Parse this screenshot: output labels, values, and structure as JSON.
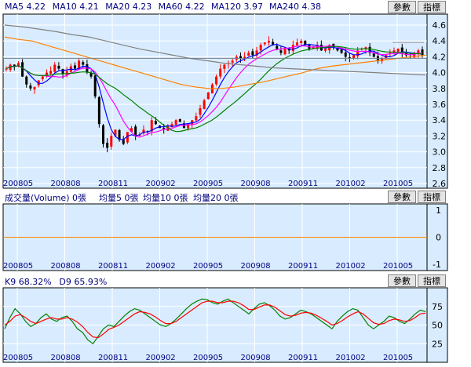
{
  "colors": {
    "background": "#ffffff",
    "plot_background": "#d9ecff",
    "axis_panel": "#d9ecff",
    "grid": "#ffffff",
    "candle_up": "#ff0000",
    "candle_down": "#000000",
    "ma5": "#0000ff",
    "ma10": "#ff00ff",
    "ma20": "#008000",
    "ma60": "#ff8000",
    "ma120": "#808080",
    "ma240": "#a0a0a0",
    "k": "#008000",
    "d": "#ff0000",
    "label": "#000080",
    "button_bg": "#e4e4e4"
  },
  "buttons": {
    "params": "參數",
    "indicator": "指標"
  },
  "chart_data": [
    {
      "type": "candlestick",
      "panel": "price",
      "legend": [
        {
          "label": "MA5",
          "value": "4.22"
        },
        {
          "label": "MA10",
          "value": "4.21"
        },
        {
          "label": "MA20",
          "value": "4.23"
        },
        {
          "label": "MA60",
          "value": "4.22"
        },
        {
          "label": "MA120",
          "value": "3.97"
        },
        {
          "label": "MA240",
          "value": "4.38"
        }
      ],
      "x_ticks": [
        "200805",
        "200808",
        "200811",
        "200902",
        "200905",
        "200908",
        "200911",
        "201002",
        "201005"
      ],
      "y_ticks": [
        "4.6",
        "4.4",
        "4.2",
        "4.0",
        "3.8",
        "3.6",
        "3.4",
        "3.2",
        "3.0",
        "2.8",
        "2.6"
      ],
      "ylim": [
        2.6,
        4.6
      ],
      "grid": true,
      "price_line": 4.18,
      "series": {
        "close": [
          4.05,
          4.1,
          4.08,
          4.12,
          3.95,
          3.85,
          3.8,
          3.82,
          3.9,
          3.95,
          4.0,
          4.02,
          4.1,
          4.05,
          3.98,
          4.02,
          4.08,
          4.05,
          4.15,
          4.1,
          4.0,
          3.95,
          3.7,
          3.35,
          3.1,
          3.05,
          3.2,
          3.28,
          3.15,
          3.1,
          3.25,
          3.3,
          3.2,
          3.22,
          3.28,
          3.25,
          3.4,
          3.35,
          3.3,
          3.28,
          3.32,
          3.35,
          3.4,
          3.38,
          3.3,
          3.35,
          3.4,
          3.45,
          3.55,
          3.65,
          3.75,
          3.85,
          3.95,
          4.05,
          4.1,
          4.12,
          4.15,
          4.2,
          4.18,
          4.2,
          4.25,
          4.22,
          4.28,
          4.35,
          4.38,
          4.4,
          4.35,
          4.3,
          4.25,
          4.3,
          4.28,
          4.35,
          4.38,
          4.4,
          4.35,
          4.3,
          4.32,
          4.35,
          4.28,
          4.3,
          4.35,
          4.32,
          4.28,
          4.25,
          4.2,
          4.18,
          4.22,
          4.28,
          4.3,
          4.32,
          4.25,
          4.2,
          4.15,
          4.18,
          4.22,
          4.25,
          4.28,
          4.3,
          4.25,
          4.22,
          4.2,
          4.25,
          4.28,
          4.22
        ],
        "volatility": 0.06
      },
      "moving_averages": {
        "ma5": {
          "color_key": "ma5"
        },
        "ma10": {
          "color_key": "ma10"
        },
        "ma20": {
          "color_key": "ma20"
        },
        "ma60": {
          "points": [
            4.45,
            4.42,
            4.4,
            4.35,
            4.3,
            4.25,
            4.2,
            4.15,
            4.1,
            4.05,
            4.0,
            3.95,
            3.9,
            3.85,
            3.82,
            3.8,
            3.8,
            3.82,
            3.85,
            3.88,
            3.92,
            3.96,
            4.0,
            4.05,
            4.08,
            4.1,
            4.12,
            4.14,
            4.16,
            4.18,
            4.2,
            4.22
          ],
          "color_key": "ma60"
        },
        "ma120": {
          "points": [
            4.6,
            4.58,
            4.55,
            4.52,
            4.48,
            4.45,
            4.4,
            4.35,
            4.3,
            4.26,
            4.22,
            4.18,
            4.15,
            4.12,
            4.1,
            4.08,
            4.06,
            4.05,
            4.04,
            4.03,
            4.02,
            4.01,
            4.0,
            3.99,
            3.98,
            3.97
          ],
          "color_key": "ma120"
        },
        "ma240": {
          "points": [
            4.38,
            4.38,
            4.38,
            4.38
          ],
          "color_key": "ma240"
        }
      }
    },
    {
      "type": "line",
      "panel": "volume",
      "title_text": "成交量(Volume) 0張",
      "legend": [
        {
          "label": "均量5",
          "value": "0張"
        },
        {
          "label": "均量10",
          "value": "0張"
        },
        {
          "label": "均量20",
          "value": "0張"
        }
      ],
      "x_ticks": [
        "200805",
        "200808",
        "200811",
        "200902",
        "200905",
        "200908",
        "200911",
        "201002",
        "201005"
      ],
      "y_ticks": [
        "1",
        "0",
        "-1"
      ],
      "ylim": [
        -1,
        1
      ],
      "series": [
        {
          "values": [
            0,
            0
          ]
        }
      ],
      "grid": true
    },
    {
      "type": "line",
      "panel": "kd",
      "legend": [
        {
          "label": "K9",
          "value": "68.32%"
        },
        {
          "label": "D9",
          "value": "65.93%"
        }
      ],
      "x_ticks": [
        "200805",
        "200808",
        "200811",
        "200902",
        "200905",
        "200908",
        "200911",
        "201002",
        "201005"
      ],
      "y_ticks": [
        "75",
        "50",
        "25"
      ],
      "ylim": [
        0,
        100
      ],
      "grid": true,
      "series": [
        {
          "key": "k",
          "values": [
            45,
            60,
            72,
            65,
            55,
            48,
            52,
            60,
            65,
            58,
            55,
            60,
            62,
            55,
            45,
            40,
            30,
            25,
            35,
            45,
            50,
            48,
            55,
            62,
            68,
            72,
            70,
            65,
            60,
            55,
            50,
            48,
            52,
            58,
            65,
            72,
            78,
            82,
            85,
            84,
            80,
            78,
            82,
            85,
            80,
            75,
            70,
            65,
            72,
            78,
            80,
            76,
            70,
            62,
            58,
            60,
            65,
            70,
            68,
            65,
            60,
            55,
            50,
            45,
            55,
            62,
            68,
            72,
            70,
            60,
            50,
            45,
            50,
            55,
            62,
            60,
            55,
            52,
            58,
            65,
            70,
            68
          ]
        },
        {
          "key": "d",
          "values": [
            50,
            55,
            62,
            64,
            60,
            55,
            52,
            55,
            58,
            60,
            58,
            58,
            60,
            58,
            54,
            48,
            40,
            34,
            33,
            38,
            44,
            47,
            50,
            55,
            60,
            65,
            68,
            67,
            65,
            61,
            56,
            52,
            52,
            55,
            60,
            65,
            70,
            75,
            80,
            82,
            82,
            80,
            80,
            82,
            82,
            80,
            76,
            71,
            71,
            74,
            77,
            77,
            74,
            69,
            64,
            62,
            63,
            66,
            67,
            66,
            63,
            59,
            55,
            50,
            52,
            56,
            61,
            65,
            68,
            65,
            59,
            53,
            51,
            52,
            56,
            58,
            57,
            55,
            56,
            60,
            65,
            66
          ]
        }
      ]
    }
  ]
}
